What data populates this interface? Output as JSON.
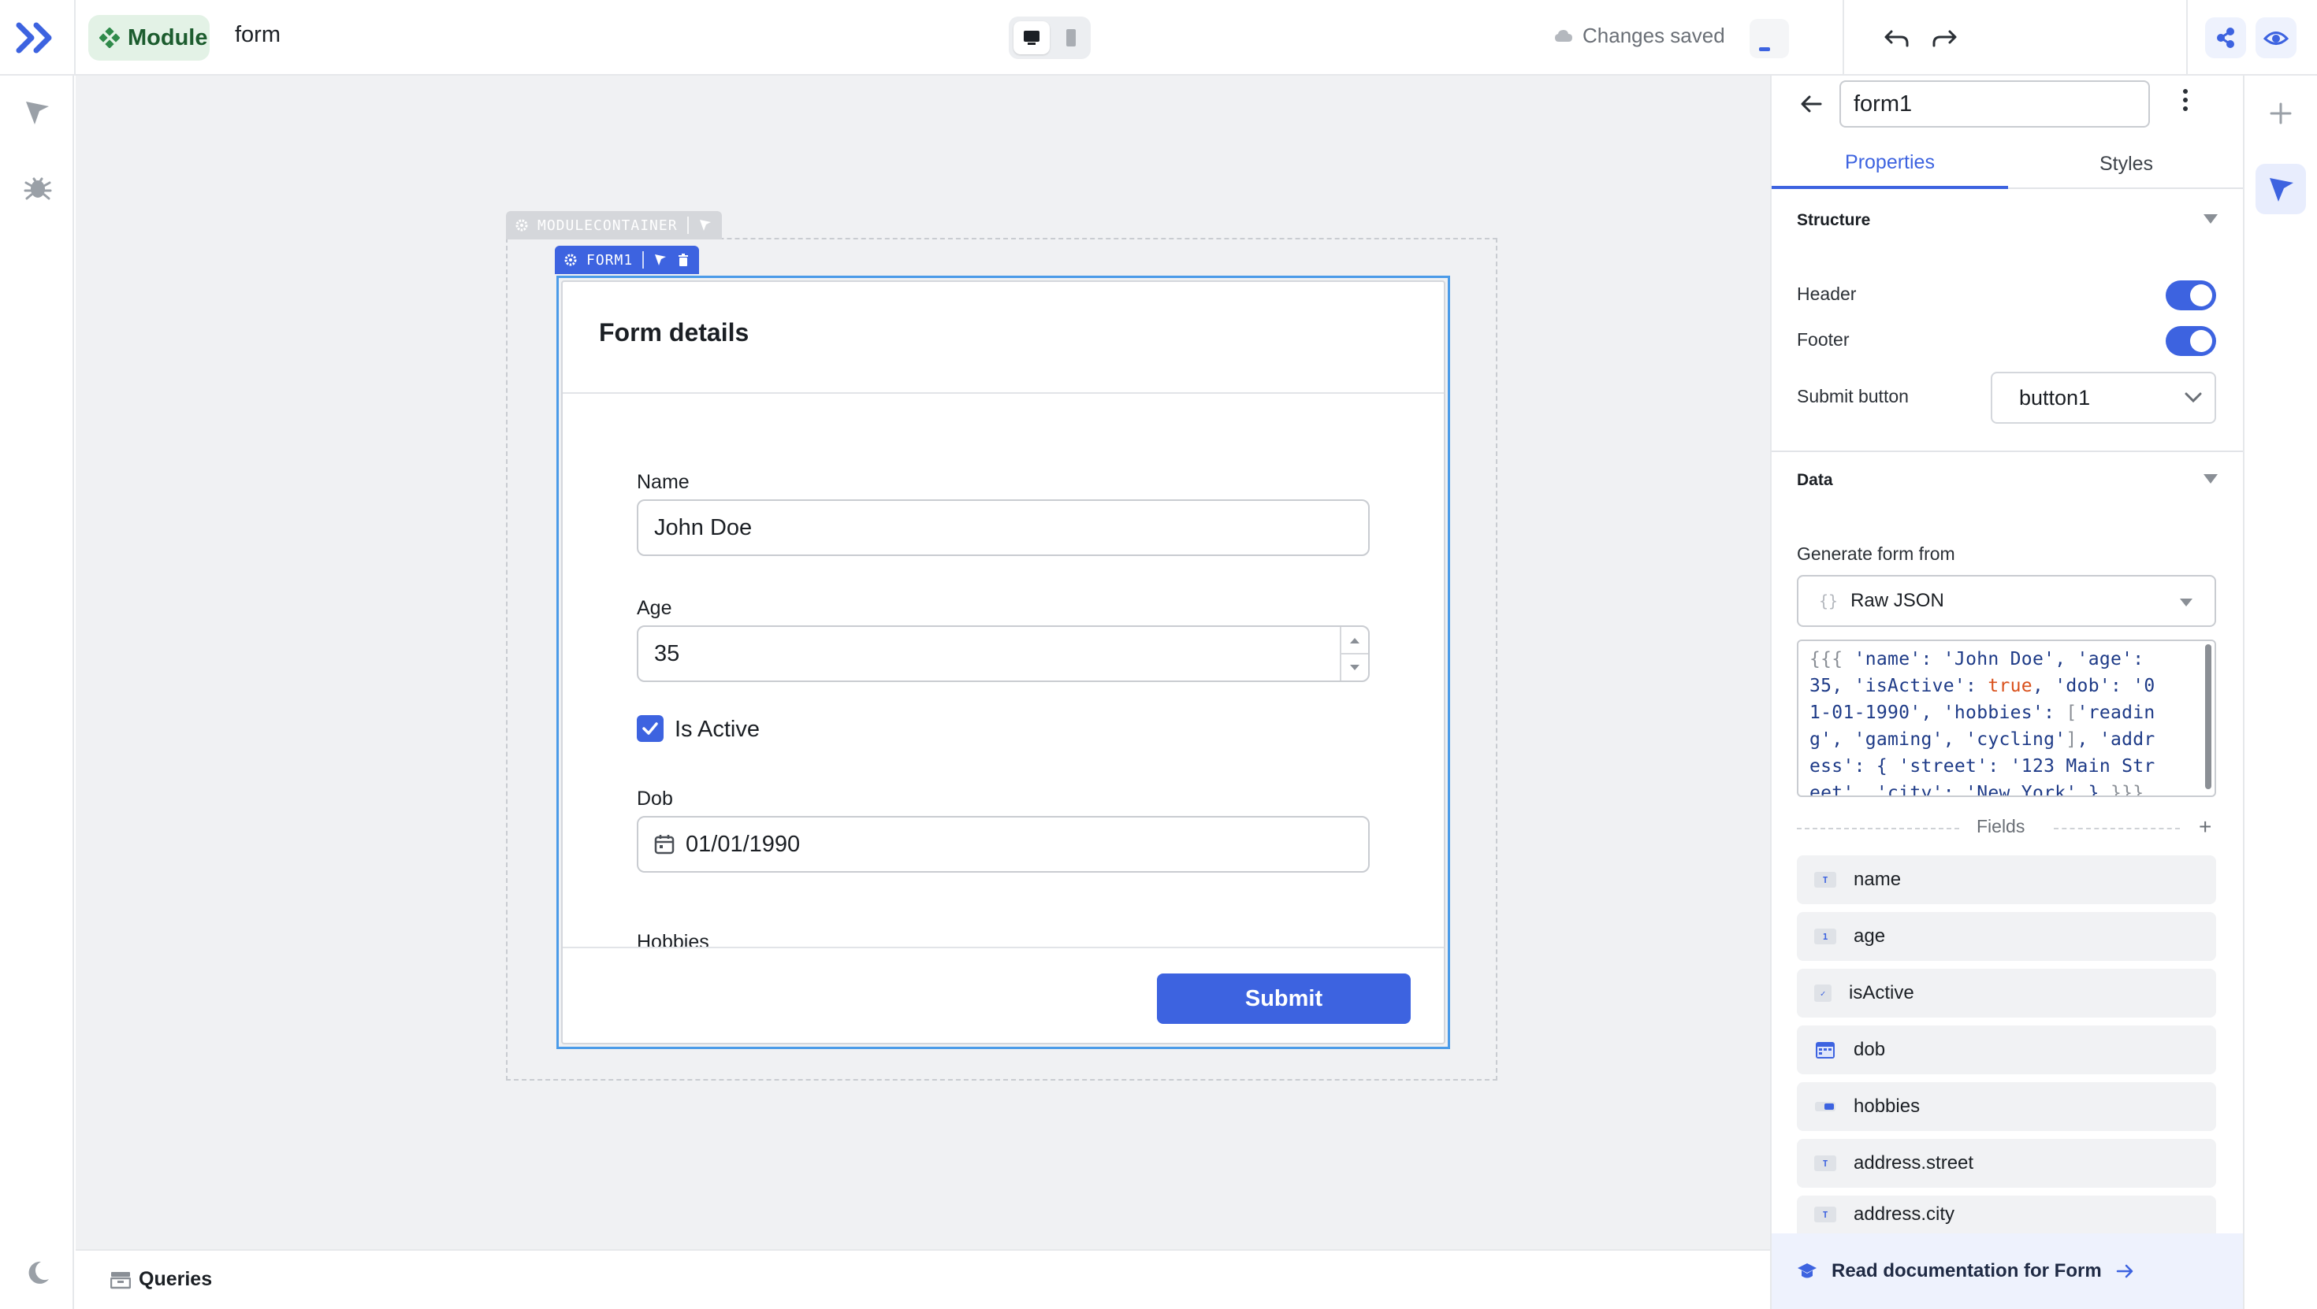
{
  "topbar": {
    "module_label": "Module",
    "app_name": "form",
    "save_status": "Changes saved"
  },
  "canvas": {
    "module_container_tag": "MODULECONTAINER",
    "form_tag": "FORM1",
    "form": {
      "title": "Form details",
      "fields": [
        {
          "label": "Name",
          "value": "John Doe"
        },
        {
          "label": "Age",
          "value": "35"
        },
        {
          "label": "Is Active",
          "checked": true
        },
        {
          "label": "Dob",
          "value": "01/01/1990"
        },
        {
          "label": "Hobbies"
        }
      ],
      "submit_label": "Submit"
    }
  },
  "bottombar": {
    "queries_label": "Queries"
  },
  "inspector": {
    "component_name": "form1",
    "tabs": [
      "Properties",
      "Styles"
    ],
    "active_tab": "Properties",
    "structure": {
      "title": "Structure",
      "header_label": "Header",
      "header_on": true,
      "footer_label": "Footer",
      "footer_on": true,
      "submit_button_label": "Submit button",
      "submit_button_value": "button1"
    },
    "data": {
      "title": "Data",
      "generate_label": "Generate form from",
      "source_value": "Raw JSON",
      "source_icon": "{}",
      "json_lines": [
        "{{{ 'name': 'John Doe', 'age':",
        "35, 'isActive': true, 'dob': '0",
        "1-01-1990', 'hobbies': ['readin",
        "g', 'gaming', 'cycling'], 'addr",
        "ess': { 'street': '123 Main Str",
        "eet', 'city': 'New York' } }}}"
      ],
      "fields_label": "Fields",
      "fields": [
        {
          "name": "name",
          "icon": "text-field-icon"
        },
        {
          "name": "age",
          "icon": "number-field-icon"
        },
        {
          "name": "isActive",
          "icon": "checkbox-field-icon"
        },
        {
          "name": "dob",
          "icon": "calendar-field-icon"
        },
        {
          "name": "hobbies",
          "icon": "multiselect-field-icon"
        },
        {
          "name": "address.street",
          "icon": "text-field-icon"
        },
        {
          "name": "address.city",
          "icon": "text-field-icon"
        }
      ]
    },
    "doc_link": "Read documentation for Form"
  },
  "colors": {
    "accent": "#3d63e0",
    "selection": "#4b9be8",
    "module_chip_bg": "#e3f2e6",
    "module_chip_text": "#1c5c2e",
    "json_keyword": "#d9511c"
  }
}
